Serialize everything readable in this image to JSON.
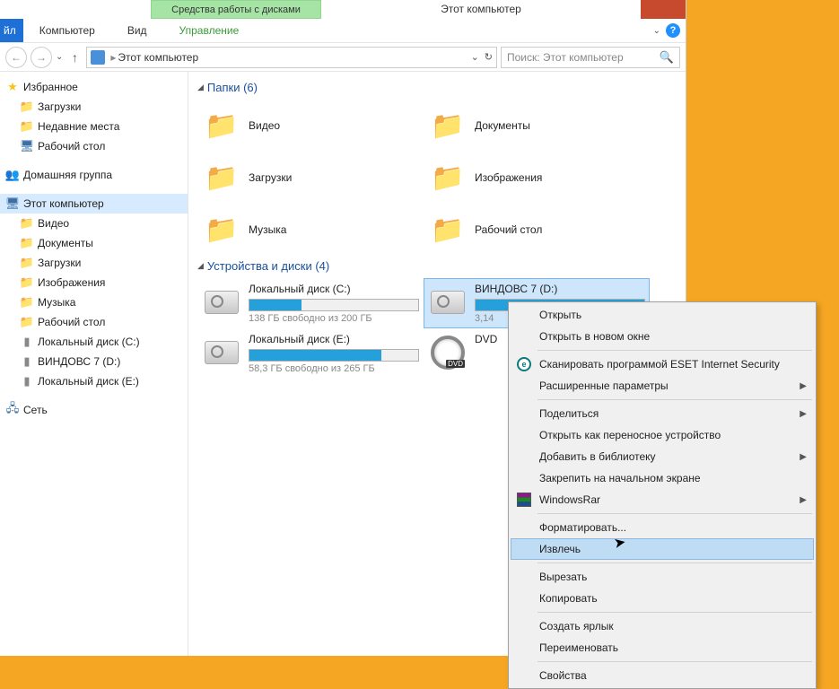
{
  "title_tools": "Средства работы с дисками",
  "window_title": "Этот компьютер",
  "ribbon": {
    "file": "йл",
    "computer": "Компьютер",
    "view": "Вид",
    "manage": "Управление"
  },
  "breadcrumb": {
    "location": "Этот компьютер"
  },
  "search": {
    "placeholder": "Поиск: Этот компьютер"
  },
  "sidebar": {
    "favorites": "Избранное",
    "fav_items": [
      "Загрузки",
      "Недавние места",
      "Рабочий стол"
    ],
    "homegroup": "Домашняя группа",
    "this_pc": "Этот компьютер",
    "pc_items": [
      "Видео",
      "Документы",
      "Загрузки",
      "Изображения",
      "Музыка",
      "Рабочий стол",
      "Локальный диск (C:)",
      "ВИНДОВС 7 (D:)",
      "Локальный диск (E:)"
    ],
    "network": "Сеть"
  },
  "folders_section": "Папки (6)",
  "folders": [
    "Видео",
    "Документы",
    "Загрузки",
    "Изображения",
    "Музыка",
    "Рабочий стол"
  ],
  "drives_section": "Устройства и диски (4)",
  "drives": [
    {
      "name": "Локальный диск (C:)",
      "free": "138 ГБ свободно из 200 ГБ",
      "pct": 31
    },
    {
      "name": "ВИНДОВС 7 (D:)",
      "free": "3,14",
      "pct": 100
    },
    {
      "name": "Локальный диск (E:)",
      "free": "58,3 ГБ свободно из 265 ГБ",
      "pct": 78
    },
    {
      "name": "DVD",
      "free": "",
      "pct": 0
    }
  ],
  "context_menu": [
    {
      "label": "Открыть"
    },
    {
      "label": "Открыть в новом окне"
    },
    {
      "sep": true
    },
    {
      "label": "Сканировать программой ESET Internet Security",
      "icon": "eset"
    },
    {
      "label": "Расширенные параметры",
      "sub": true
    },
    {
      "sep": true
    },
    {
      "label": "Поделиться",
      "sub": true
    },
    {
      "label": "Открыть как переносное устройство"
    },
    {
      "label": "Добавить в библиотеку",
      "sub": true
    },
    {
      "label": "Закрепить на начальном экране"
    },
    {
      "label": "WindowsRar",
      "icon": "rar",
      "sub": true
    },
    {
      "sep": true
    },
    {
      "label": "Форматировать..."
    },
    {
      "label": "Извлечь",
      "hover": true
    },
    {
      "sep": true
    },
    {
      "label": "Вырезать"
    },
    {
      "label": "Копировать"
    },
    {
      "sep": true
    },
    {
      "label": "Создать ярлык"
    },
    {
      "label": "Переименовать"
    },
    {
      "sep": true
    },
    {
      "label": "Свойства"
    }
  ]
}
